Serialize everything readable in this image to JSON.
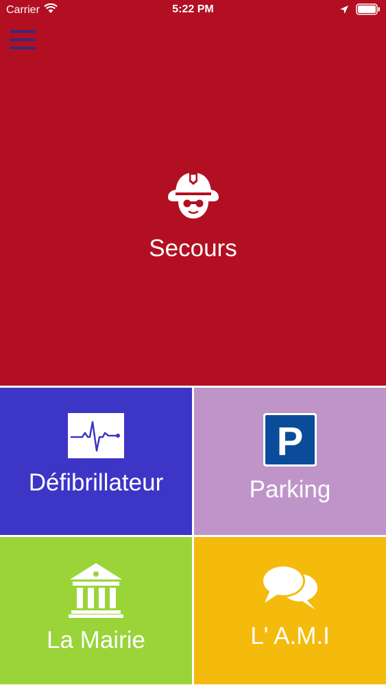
{
  "status_bar": {
    "carrier": "Carrier",
    "time": "5:22 PM",
    "icons": [
      "wifi-icon",
      "location-arrow-icon",
      "battery-icon"
    ]
  },
  "menu": {
    "icon": "hamburger-menu-icon",
    "color": "#3b2a78"
  },
  "tiles": [
    {
      "label": "Secours",
      "icon": "firefighter-icon",
      "color": "#b30f22"
    },
    {
      "label": "Défibrillateur",
      "icon": "heartbeat-monitor-icon",
      "color": "#3d35c6"
    },
    {
      "label": "Parking",
      "icon": "parking-sign-icon",
      "color": "#bf95c9"
    },
    {
      "label": "La Mairie",
      "icon": "town-hall-icon",
      "color": "#9ad439"
    },
    {
      "label": "L' A.M.I",
      "icon": "chat-bubbles-icon",
      "color": "#f4bb0d"
    }
  ]
}
